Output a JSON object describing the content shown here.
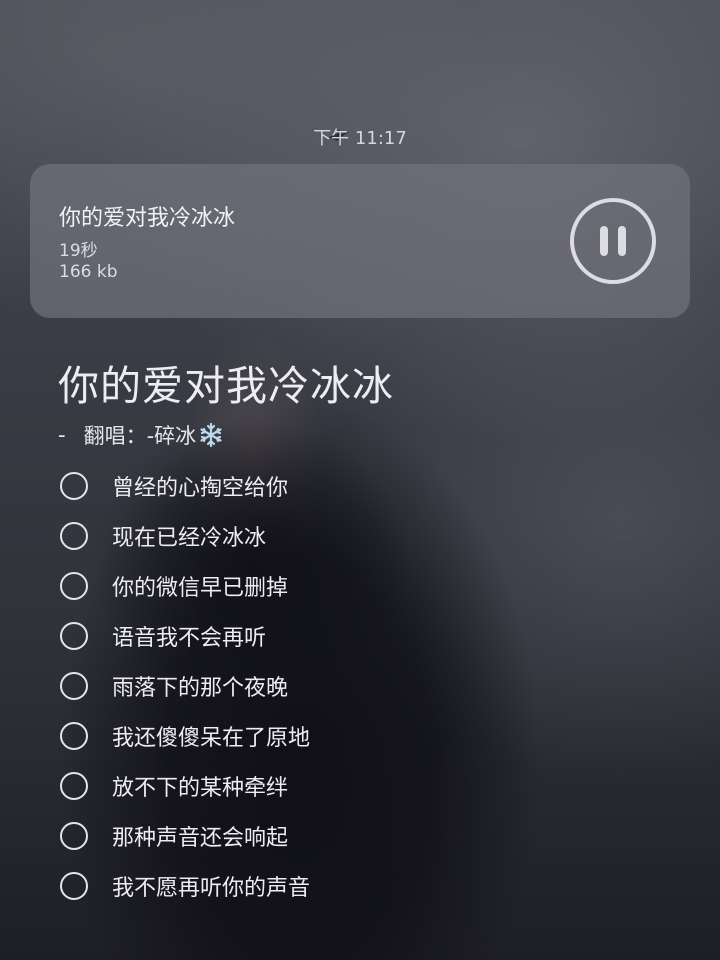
{
  "status_bar": {
    "time": "下午 11:17"
  },
  "player": {
    "title": "你的爱对我冷冰冰",
    "duration": "19秒",
    "size": "166 kb",
    "control_icon": "pause-icon"
  },
  "song": {
    "title": "你的爱对我冷冰冰",
    "credit_dash": "-",
    "credit": "翻唱：-碎冰",
    "credit_icon": "snowflake-icon"
  },
  "lyrics": [
    "曾经的心掏空给你",
    "现在已经冷冰冰",
    "你的微信早已删掉",
    "语音我不会再听",
    "雨落下的那个夜晚",
    "我还傻傻呆在了原地",
    "放不下的某种牵绊",
    "那种声音还会响起",
    "我不愿再听你的声音"
  ],
  "colors": {
    "card_background": "#70727c",
    "text_primary": "#ececf1",
    "snowflake": "#b9d8ee"
  }
}
